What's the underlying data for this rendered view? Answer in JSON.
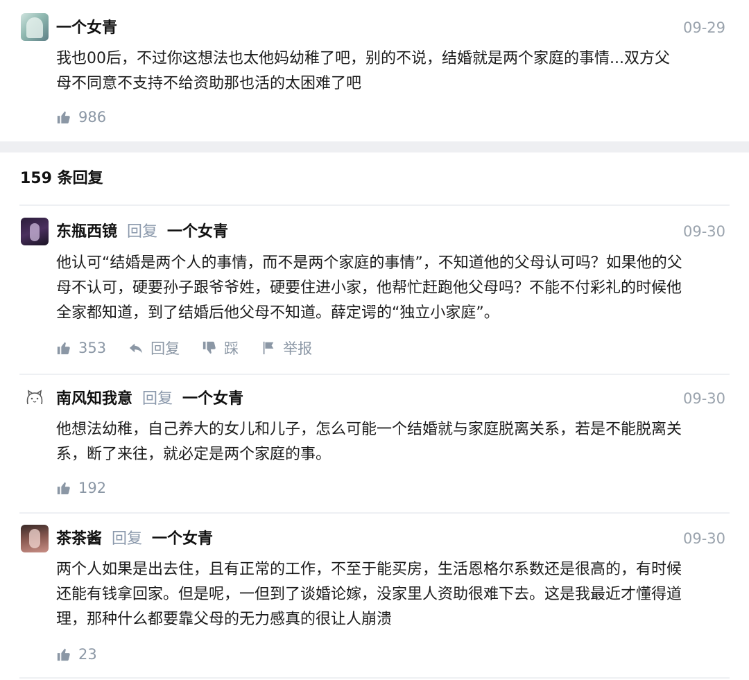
{
  "main_comment": {
    "author": "一个女青",
    "date": "09-29",
    "lines": [
      "我也00后，不过你这想法也太他妈幼稚了吧，别的不说，结婚就是两个家庭的事情...双方父",
      "母不同意不支持不给资助那也活的太困难了吧"
    ],
    "likes": "986"
  },
  "replies_header": "159 条回复",
  "replies": [
    {
      "author": "东瓶西镜",
      "reply_word": "回复",
      "reply_to": "一个女青",
      "date": "09-30",
      "lines": [
        "他认可“结婚是两个人的事情，而不是两个家庭的事情”，不知道他的父母认可吗？如果他的父",
        "母不认可，硬要孙子跟爷爷姓，硬要住进小家，他帮忙赶跑他父母吗？不能不付彩礼的时候他",
        "全家都知道，到了结婚后他父母不知道。薛定谔的“独立小家庭”。"
      ],
      "likes": "353",
      "reply_label": "回复",
      "dislike_label": "踩",
      "report_label": "举报"
    },
    {
      "author": "南风知我意",
      "reply_word": "回复",
      "reply_to": "一个女青",
      "date": "09-30",
      "lines": [
        "他想法幼稚，自己养大的女儿和儿子，怎么可能一个结婚就与家庭脱离关系，若是不能脱离关",
        "系，断了来往，就必定是两个家庭的事。"
      ],
      "likes": "192"
    },
    {
      "author": "茶茶酱",
      "reply_word": "回复",
      "reply_to": "一个女青",
      "date": "09-30",
      "lines": [
        "两个人如果是出去住，且有正常的工作，不至于能买房，生活恩格尔系数还是很高的，有时候",
        "还能有钱拿回家。但是呢，一但到了谈婚论嫁，没家里人资助很难下去。这是我最近才懂得道",
        "理，那种什么都要靠父母的无力感真的很让人崩溃"
      ],
      "likes": "23"
    }
  ],
  "colors": {
    "meta_gray": "#8b97a5",
    "divider": "#eef0f3",
    "band": "#eeeff2"
  }
}
